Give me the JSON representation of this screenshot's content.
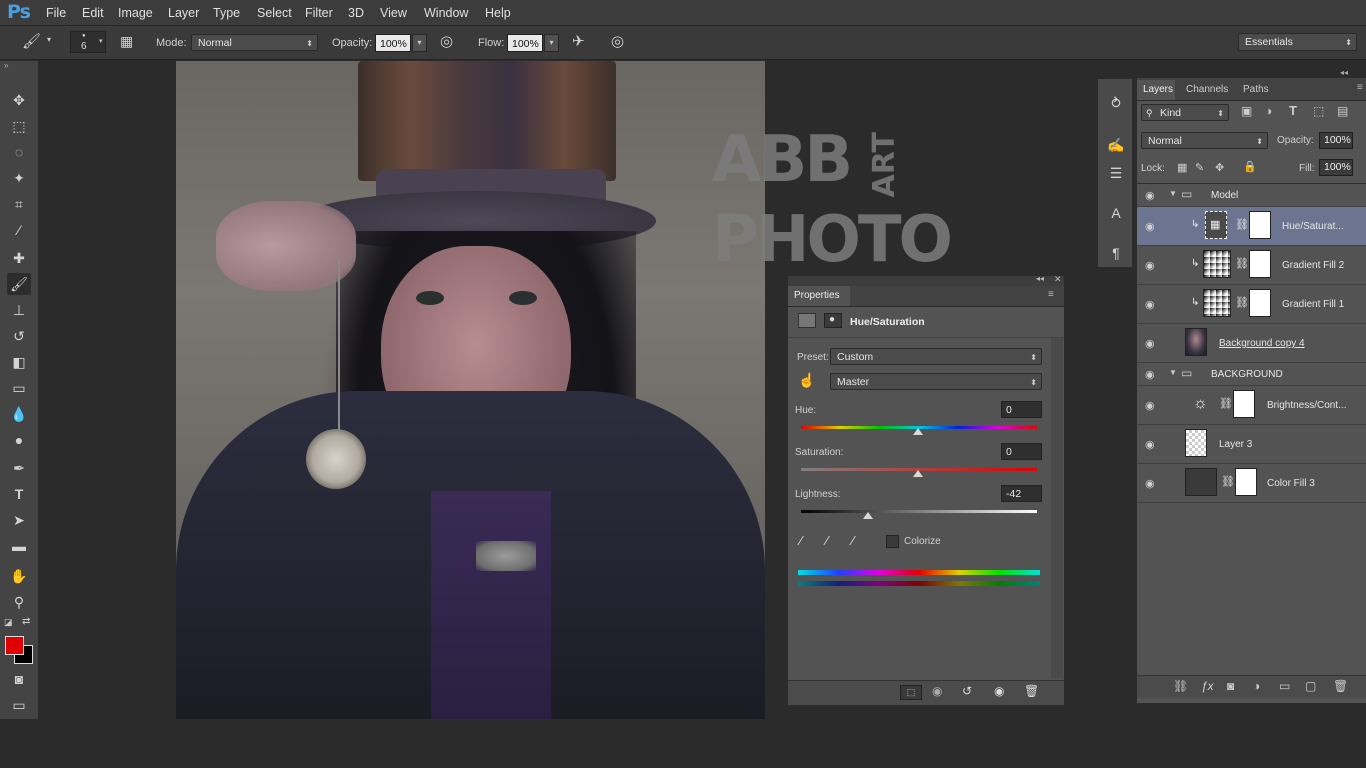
{
  "app": {
    "logo": "Ps"
  },
  "menu": [
    "File",
    "Edit",
    "Image",
    "Layer",
    "Type",
    "Select",
    "Filter",
    "3D",
    "View",
    "Window",
    "Help"
  ],
  "options": {
    "brush_size": "6",
    "mode_label": "Mode:",
    "mode_value": "Normal",
    "opacity_label": "Opacity:",
    "opacity_value": "100%",
    "flow_label": "Flow:",
    "flow_value": "100%",
    "workspace": "Essentials"
  },
  "watermark": {
    "line1": "ABB",
    "vertical": "ART",
    "line2": "PHOTO"
  },
  "properties": {
    "title": "Properties",
    "adjustment": "Hue/Saturation",
    "preset_label": "Preset:",
    "preset_value": "Custom",
    "channel": "Master",
    "hue_label": "Hue:",
    "hue_value": "0",
    "saturation_label": "Saturation:",
    "saturation_value": "0",
    "lightness_label": "Lightness:",
    "lightness_value": "-42",
    "colorize_label": "Colorize"
  },
  "layers_panel": {
    "tabs": [
      "Layers",
      "Channels",
      "Paths"
    ],
    "filter_kind": "Kind",
    "blend_mode": "Normal",
    "opacity_label": "Opacity:",
    "opacity_value": "100%",
    "lock_label": "Lock:",
    "fill_label": "Fill:",
    "fill_value": "100%",
    "layers": [
      {
        "name": "Model"
      },
      {
        "name": "Hue/Saturat..."
      },
      {
        "name": "Gradient Fill 2"
      },
      {
        "name": "Gradient Fill 1"
      },
      {
        "name": "Background copy 4"
      },
      {
        "name": "BACKGROUND"
      },
      {
        "name": "Brightness/Cont..."
      },
      {
        "name": "Layer 3"
      },
      {
        "name": "Color Fill 3"
      }
    ]
  },
  "colors": {
    "foreground": "#e00000",
    "background": "#000000",
    "selected_layer": "#6c7590"
  }
}
